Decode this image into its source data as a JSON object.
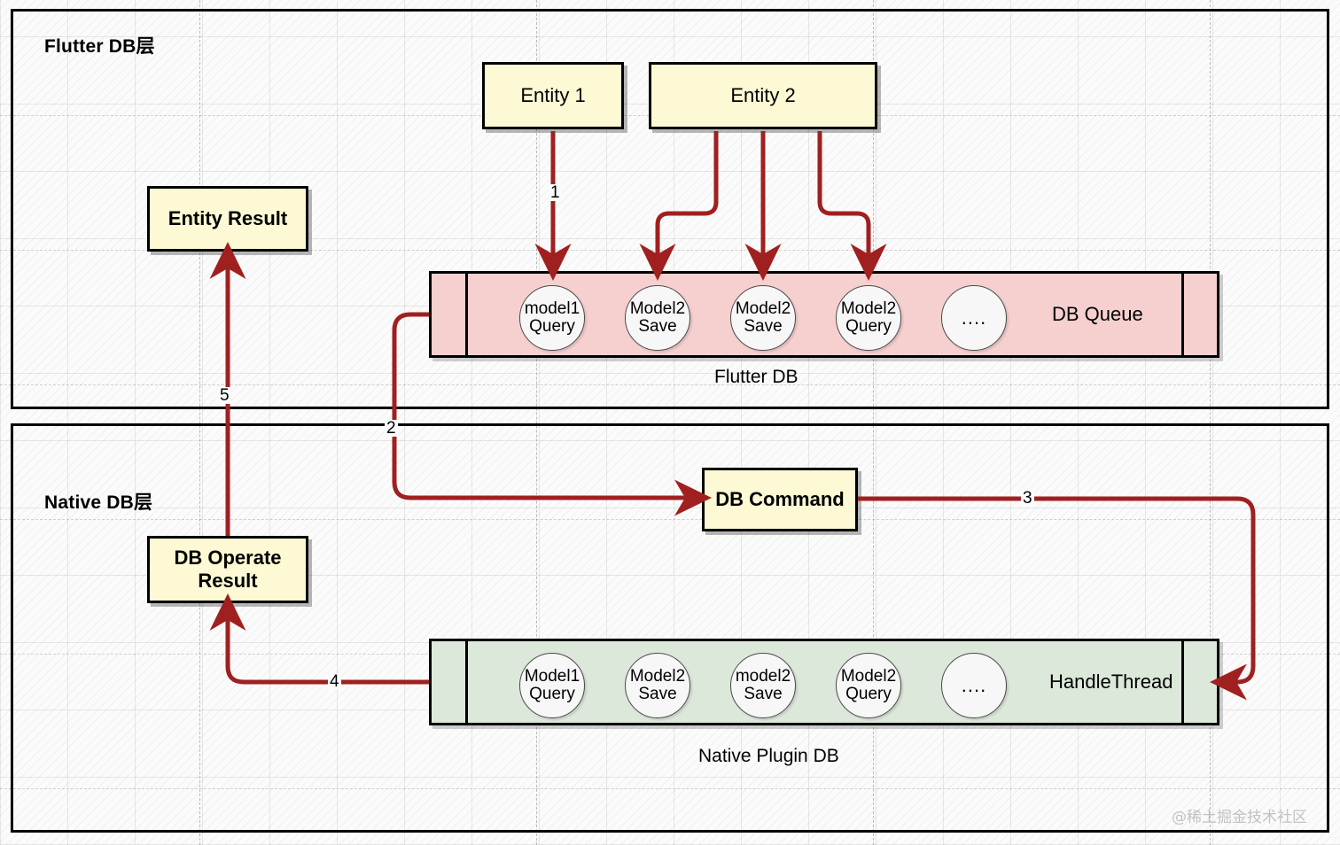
{
  "diagram": {
    "title": "Flutter DB / Native DB architecture",
    "accent_arrow_color": "#A02020",
    "box_fill": "#FCF9D4",
    "pink_queue_fill": "#F6CFCF",
    "green_queue_fill": "#DCE8DA"
  },
  "lanes": [
    {
      "id": "flutter",
      "title": "Flutter DB层"
    },
    {
      "id": "native",
      "title": "Native DB层"
    }
  ],
  "boxes": {
    "entity1": "Entity 1",
    "entity2": "Entity 2",
    "entity_result": "Entity Result",
    "db_command": "DB Command",
    "db_operate_result_line1": "DB Operate",
    "db_operate_result_line2": "Result"
  },
  "flutter_queue": {
    "label": "DB Queue",
    "caption": "Flutter DB",
    "items": [
      {
        "line1": "model1",
        "line2": "Query"
      },
      {
        "line1": "Model2",
        "line2": "Save"
      },
      {
        "line1": "Model2",
        "line2": "Save"
      },
      {
        "line1": "Model2",
        "line2": "Query"
      },
      {
        "line1": "....",
        "line2": ""
      }
    ]
  },
  "native_queue": {
    "label": "HandleThread",
    "caption": "Native Plugin DB",
    "items": [
      {
        "line1": "Model1",
        "line2": "Query"
      },
      {
        "line1": "Model2",
        "line2": "Save"
      },
      {
        "line1": "model2",
        "line2": "Save"
      },
      {
        "line1": "Model2",
        "line2": "Query"
      },
      {
        "line1": "....",
        "line2": ""
      }
    ]
  },
  "arrow_labels": {
    "n1": "1",
    "n2": "2",
    "n3": "3",
    "n4": "4",
    "n5": "5"
  },
  "watermark": "@稀土掘金技术社区"
}
